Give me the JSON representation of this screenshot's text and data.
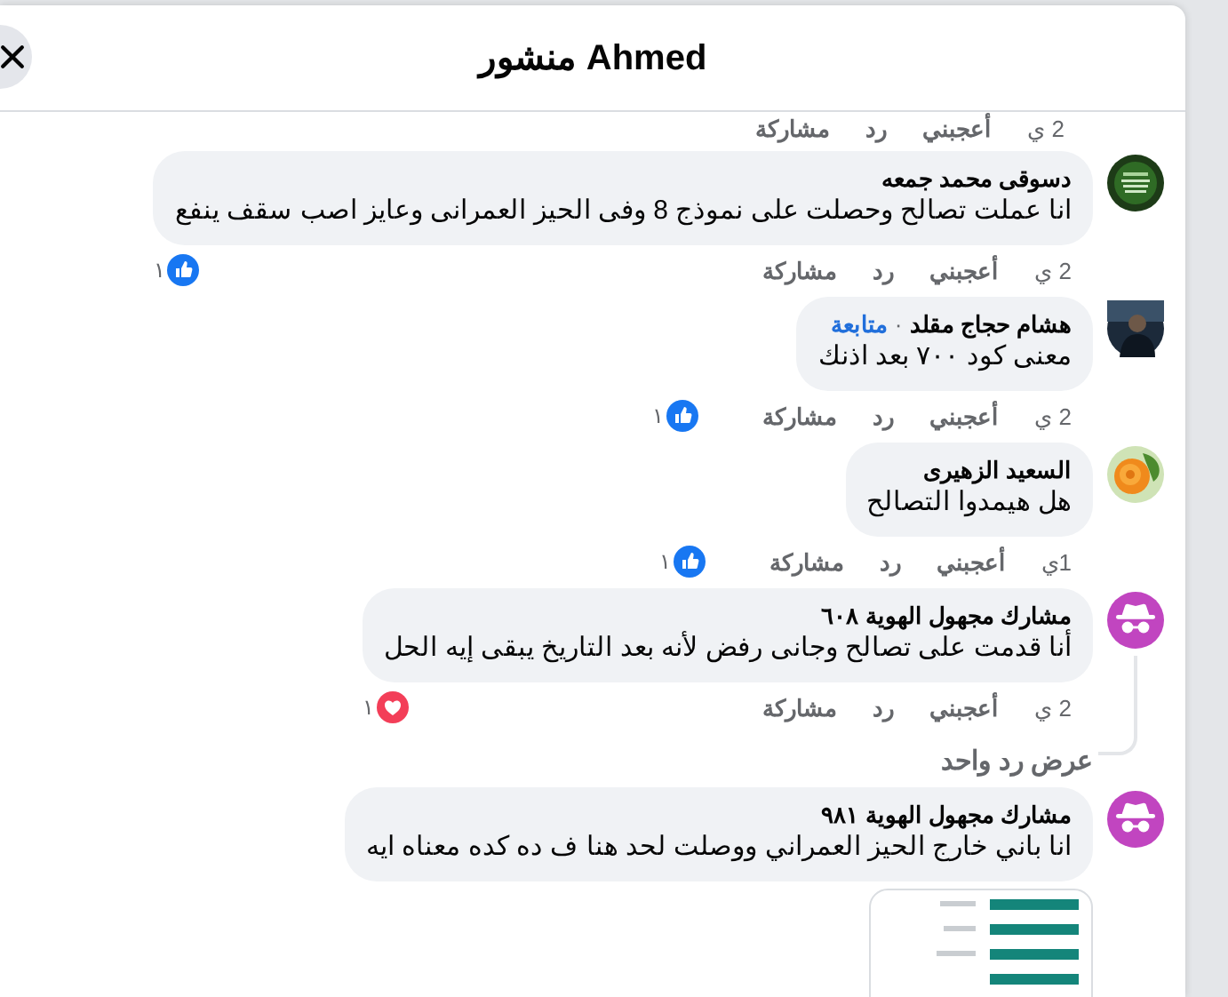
{
  "header": {
    "title": "منشور Ahmed"
  },
  "top_actions": {
    "time": "2 ي",
    "like": "أعجبني",
    "reply": "رد",
    "share": "مشاركة"
  },
  "comments": [
    {
      "author": "دسوقى محمد جمعه",
      "text": "انا عملت تصالح وحصلت على نموذج 8 وفى الحيز العمرانى وعايز اصب سقف ينفع",
      "time": "2 ي",
      "like": "أعجبني",
      "reply": "رد",
      "share": "مشاركة",
      "reaction": {
        "kind": "like",
        "count": "١"
      }
    },
    {
      "author": "هشام حجاج مقلد",
      "separator": "·",
      "follow": "متابعة",
      "text": "معنى كود ٧٠٠ بعد اذنك",
      "time": "2 ي",
      "like": "أعجبني",
      "reply": "رد",
      "share": "مشاركة",
      "reaction": {
        "kind": "like",
        "count": "١"
      }
    },
    {
      "author": "السعيد الزهيرى",
      "text": "هل هيمدوا التصالح",
      "time": "1ي",
      "like": "أعجبني",
      "reply": "رد",
      "share": "مشاركة",
      "reaction": {
        "kind": "like",
        "count": "١"
      }
    },
    {
      "avatar": {
        "kind": "anonymous"
      },
      "author": "مشارك مجهول الهوية ٦٠٨",
      "text": "أنا قدمت على تصالح وجانى رفض لأنه بعد التاريخ يبقى إيه الحل",
      "time": "2 ي",
      "like": "أعجبني",
      "reply": "رد",
      "share": "مشاركة",
      "reaction": {
        "kind": "love",
        "count": "١"
      },
      "replies_link": "عرض رد واحد"
    },
    {
      "avatar": {
        "kind": "anonymous"
      },
      "author": "مشارك مجهول الهوية ٩٨١",
      "text": "انا باني خارج الحيز العمراني ووصلت لحد هنا ف ده كده معناه ايه"
    }
  ]
}
